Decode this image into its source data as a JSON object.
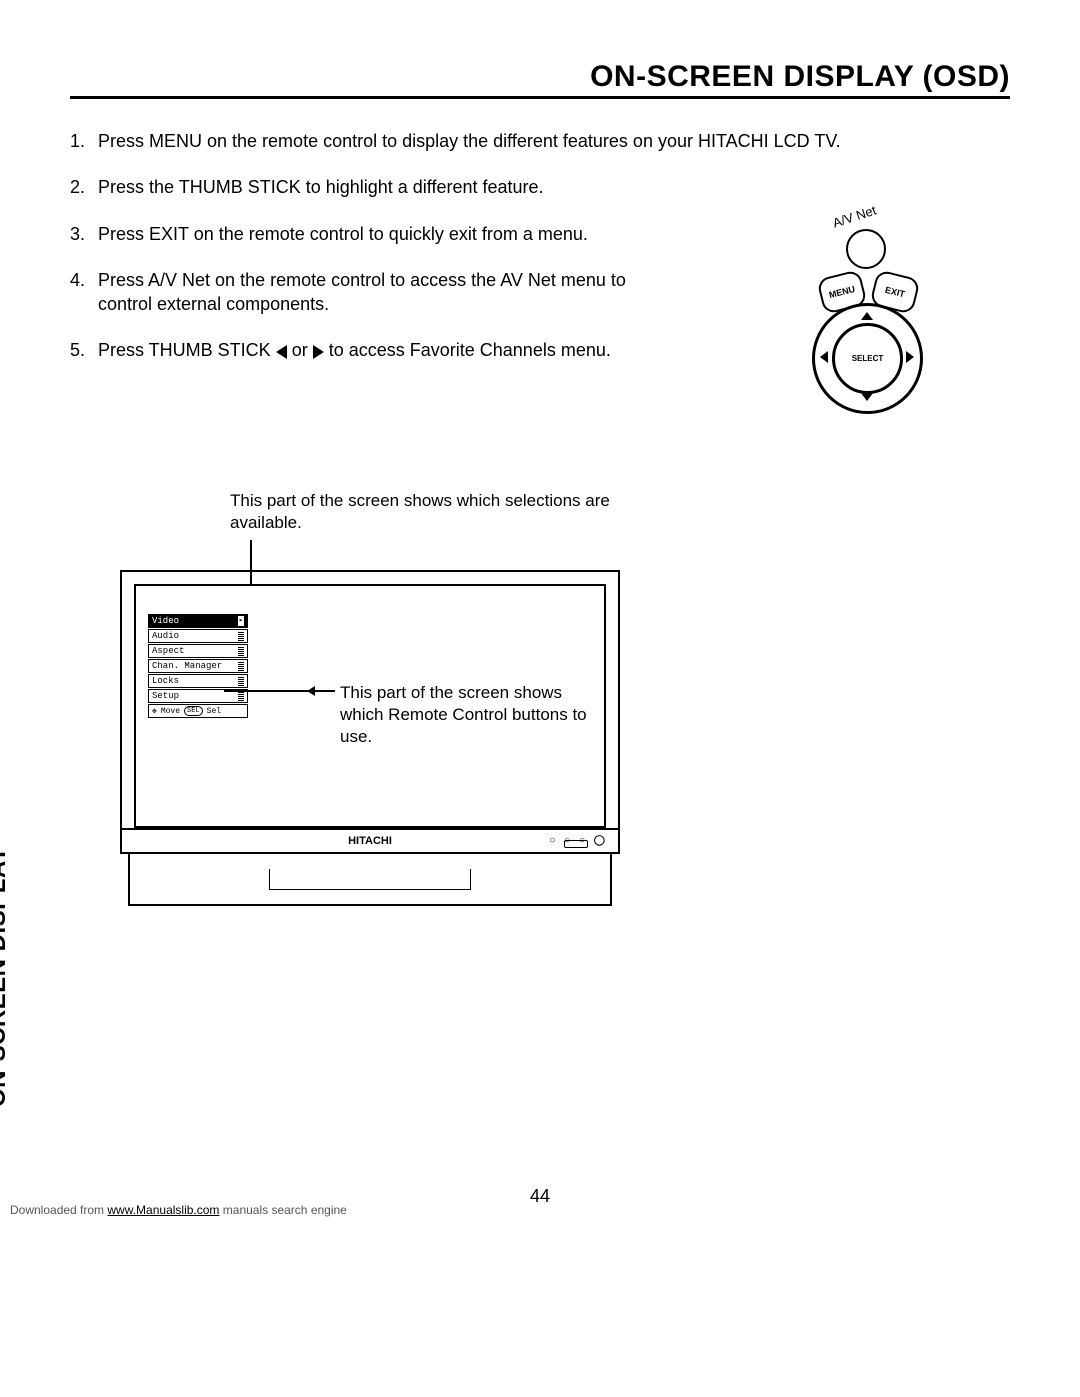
{
  "header": {
    "title": "ON-SCREEN DISPLAY (OSD)"
  },
  "steps": [
    {
      "num": "1.",
      "text": "Press MENU on the remote control to display the different features on your HITACHI LCD TV."
    },
    {
      "num": "2.",
      "text": "Press the THUMB STICK to highlight a different feature."
    },
    {
      "num": "3.",
      "text": "Press EXIT on the remote control to quickly exit from a menu."
    },
    {
      "num": "4.",
      "text": "Press A/V Net on the remote control to access the AV Net menu to control external components."
    },
    {
      "num": "5.",
      "text_a": "Press THUMB STICK ",
      "text_b": " or ",
      "text_c": " to access Favorite Channels menu."
    }
  ],
  "remote": {
    "avnet": "A/V Net",
    "menu": "MENU",
    "exit": "EXIT",
    "select": "SELECT"
  },
  "figure": {
    "callout1": "This part of the screen shows which selections are available.",
    "callout2": "This part of the screen shows which Remote Control buttons to use.",
    "brand": "HITACHI",
    "menu_items": [
      "Video",
      "Audio",
      "Aspect",
      "Chan. Manager",
      "Locks",
      "Setup"
    ],
    "hint_move": "Move",
    "hint_sel": "Sel",
    "hint_sel_icon": "SEL"
  },
  "vtab": "ON-SCREEN DISPLAY",
  "pagenum": "44",
  "footer": {
    "prefix": "Downloaded from ",
    "link": "www.Manualslib.com",
    "suffix": " manuals search engine"
  }
}
